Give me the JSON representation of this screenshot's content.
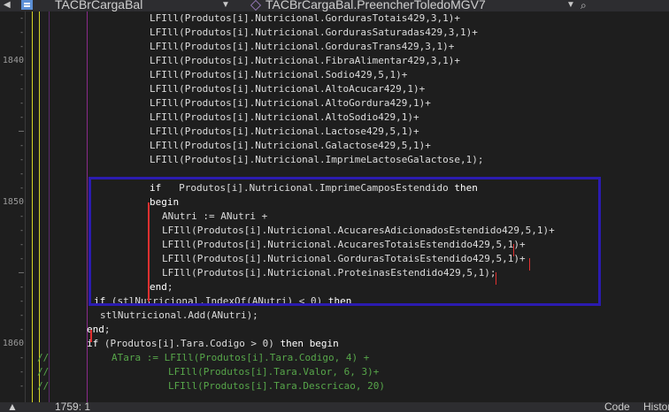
{
  "toolbar": {
    "class_name": "TACBrCargaBal",
    "method_name": "TACBrCargaBal.PreencherToledoMGV7"
  },
  "editor": {
    "lines": [
      {
        "ln": "",
        "text": "LFIll(Produtos[i].Nutricional.GordurasTotais429,3,1)+"
      },
      {
        "ln": "",
        "text": "LFIll(Produtos[i].Nutricional.GordurasSaturadas429,3,1)+"
      },
      {
        "ln": "",
        "text": "LFIll(Produtos[i].Nutricional.GordurasTrans429,3,1)+"
      },
      {
        "ln": "1840",
        "text": "LFIll(Produtos[i].Nutricional.FibraAlimentar429,3,1)+"
      },
      {
        "ln": "",
        "text": "LFIll(Produtos[i].Nutricional.Sodio429,5,1)+"
      },
      {
        "ln": "",
        "text": "LFIll(Produtos[i].Nutricional.AltoAcucar429,1)+"
      },
      {
        "ln": "",
        "text": "LFIll(Produtos[i].Nutricional.AltoGordura429,1)+"
      },
      {
        "ln": "",
        "text": "LFIll(Produtos[i].Nutricional.AltoSodio429,1)+"
      },
      {
        "ln": "–",
        "text": "LFIll(Produtos[i].Nutricional.Lactose429,5,1)+"
      },
      {
        "ln": "",
        "text": "LFIll(Produtos[i].Nutricional.Galactose429,5,1)+"
      },
      {
        "ln": "",
        "text": "LFIll(Produtos[i].Nutricional.ImprimeLactoseGalactose,1);"
      },
      {
        "ln": "",
        "text": ""
      },
      {
        "ln": "",
        "text": "if   Produtos[i].Nutricional.ImprimeCamposEstendido then"
      },
      {
        "ln": "1850",
        "text": "begin"
      },
      {
        "ln": "",
        "text": "ANutri := ANutri +"
      },
      {
        "ln": "",
        "text": "LFIll(Produtos[i].Nutricional.AcucaresAdicionadosEstendido429,5,1)+"
      },
      {
        "ln": "",
        "text": "LFIll(Produtos[i].Nutricional.AcucaresTotaisEstendido429,5,1)+"
      },
      {
        "ln": "",
        "text": "LFIll(Produtos[i].Nutricional.GordurasTotaisEstendido429,5,1)+"
      },
      {
        "ln": "–",
        "text": "LFIll(Produtos[i].Nutricional.ProteinasEstendido429,5,1);"
      },
      {
        "ln": "",
        "text": "end;"
      },
      {
        "ln": "",
        "text": "if (stlNutricional.IndexOf(ANutri) < 0) then"
      },
      {
        "ln": "",
        "text": "stlNutricional.Add(ANutri);"
      },
      {
        "ln": "",
        "text": "end;"
      },
      {
        "ln": "1860",
        "text": "if (Produtos[i].Tara.Codigo > 0) then begin"
      },
      {
        "ln": "",
        "text": "ATara := LFIll(Produtos[i].Tara.Codigo, 4) +"
      },
      {
        "ln": "",
        "text": "LFIll(Produtos[i].Tara.Valor, 6, 3)+"
      },
      {
        "ln": "",
        "text": "LFIll(Produtos[i].Tara.Descricao, 20)"
      }
    ],
    "comment_prefix": "//"
  },
  "statusbar": {
    "left": "1759: 1",
    "right": "Code",
    "right2": "History"
  },
  "colors": {
    "background": "#1e1e1e",
    "highlight_box": "#2b1bb0",
    "keyword": "#ffffff",
    "comment": "#57a64a"
  }
}
